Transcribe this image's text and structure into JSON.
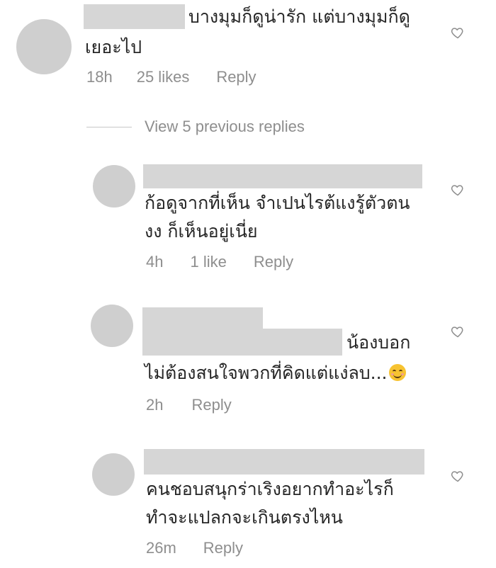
{
  "comments": [
    {
      "text_lines": [
        "บางมุมก็ดูน่ารัก แต่บางมุมก็ดู",
        "เยอะไป"
      ],
      "time": "18h",
      "likes": "25 likes",
      "reply": "Reply",
      "like_icon": "heart-outline-icon"
    }
  ],
  "view_previous": "View 5 previous replies",
  "replies": [
    {
      "text_lines": [
        "ก้อดูจากที่เห็น จำเปนไรต้แงรู้ตัวตน",
        "งง ก็เห็นอยู่เนี่ย"
      ],
      "time": "4h",
      "likes": "1 like",
      "reply": "Reply",
      "like_icon": "heart-outline-icon"
    },
    {
      "text_lines": [
        "น้องบอก",
        "ไม่ต้องสนใจพวกที่คิดแต่แง่ลบ..."
      ],
      "emoji": "smiling-face-emoji",
      "time": "2h",
      "reply": "Reply",
      "like_icon": "heart-outline-icon"
    },
    {
      "text_lines": [
        "คนชอบสนุกร่าเริงอยากทำอะไรก็",
        "ทำจะแปลกจะเกินตรงไหน"
      ],
      "time": "26m",
      "reply": "Reply",
      "like_icon": "heart-outline-icon"
    }
  ]
}
